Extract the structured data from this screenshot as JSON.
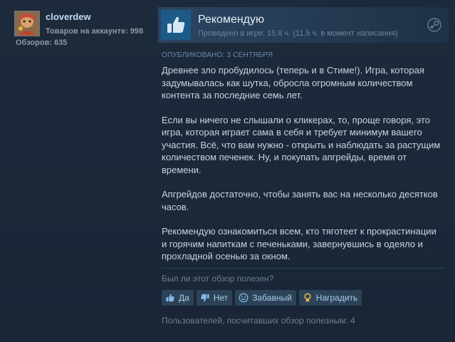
{
  "author": {
    "name": "cloverdew",
    "products_owned": "Товаров на аккаунте: 998",
    "reviews_count": "Обзоров: 635"
  },
  "review": {
    "verdict": "Рекомендую",
    "playtime": "Проведено в игре: 15.8 ч. (11.5 ч. в момент написания)",
    "posted": "Опубликовано: 3 сентября",
    "paragraphs": [
      "Древнее зло пробудилось (теперь и в Стиме!). Игра, которая задумывалась как шутка, обросла огромным количеством контента за последние семь лет.",
      "Если вы ничего не слышали о кликерах, то, проще говоря, это игра, которая играет сама в себя и требует минимум вашего участия. Всё, что вам нужно - открыть и наблюдать за растущим количеством печенек. Ну, и покупать апгрейды, время от времени.",
      "Апгрейдов достаточно, чтобы занять вас на несколько десятков часов.",
      "Рекомендую ознакомиться всем, кто тяготеет к прокрастинации и горячим напиткам с печеньками, завернувшись в одеяло и прохладной осенью за окном."
    ],
    "helpful_question": "Был ли этот обзор полезен?",
    "buttons": {
      "yes": "Да",
      "no": "Нет",
      "funny": "Забавный",
      "award": "Наградить"
    },
    "helpful_count": "Пользователей, посчитавших обзор полезным: 4"
  },
  "icons": {
    "thumb": "thumbs-up-icon",
    "steam": "steam-icon",
    "yes": "thumbs-up-icon",
    "no": "thumbs-down-icon",
    "funny": "smiley-icon",
    "award": "award-icon"
  },
  "colors": {
    "background": "#1b2838",
    "accent": "#66c0f4",
    "thumb_box": "#1c5a87"
  }
}
